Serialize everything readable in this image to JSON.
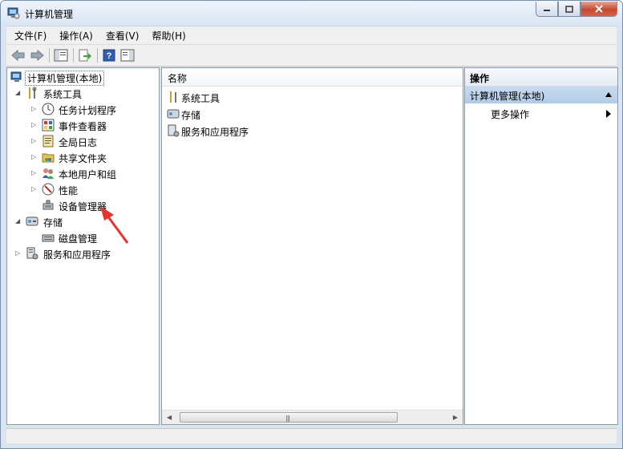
{
  "window": {
    "title": "计算机管理"
  },
  "menu": [
    "文件(F)",
    "操作(A)",
    "查看(V)",
    "帮助(H)"
  ],
  "toolbar": {
    "buttons": [
      "back-icon",
      "forward-icon",
      "show-hide-console-tree-icon",
      "export-list-icon",
      "help-icon",
      "show-hide-action-pane-icon"
    ]
  },
  "tree": {
    "root": "计算机管理(本地)",
    "system_tools": "系统工具",
    "task_scheduler": "任务计划程序",
    "event_viewer": "事件查看器",
    "global_log": "全局日志",
    "shared_folders": "共享文件夹",
    "local_users": "本地用户和组",
    "performance": "性能",
    "device_manager": "设备管理器",
    "storage": "存储",
    "disk_management": "磁盘管理",
    "services_apps": "服务和应用程序"
  },
  "list": {
    "column_name": "名称",
    "items": [
      "系统工具",
      "存储",
      "服务和应用程序"
    ]
  },
  "actions": {
    "header": "操作",
    "section": "计算机管理(本地)",
    "more": "更多操作"
  },
  "colors": {
    "annotation_arrow": "#e8322b",
    "selected_bg": "#c4d9ef"
  }
}
